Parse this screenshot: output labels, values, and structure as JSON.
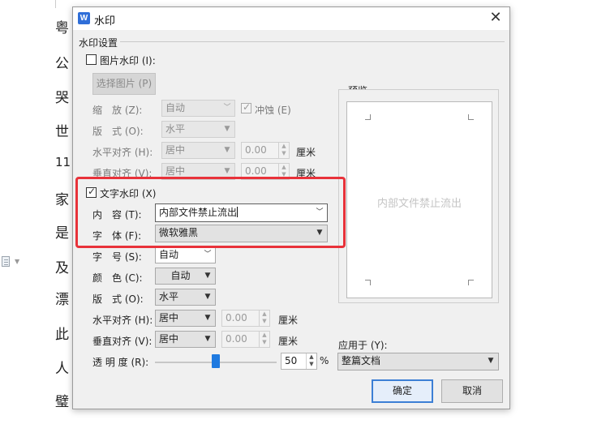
{
  "background_doc": {
    "chars": [
      "粤",
      "公",
      "哭",
      "世",
      "11",
      "家",
      "是",
      "及",
      "漂",
      "此",
      "人",
      "璧"
    ]
  },
  "dialog": {
    "title": "水印",
    "close_glyph": "✕",
    "section_label": "水印设置",
    "picture": {
      "checkbox_label": "图片水印 (I):",
      "choose_btn": "选择图片 (P)",
      "scale_label": "缩　放 (Z):",
      "scale_value": "自动",
      "washout_label": "冲蚀 (E)",
      "layout_label": "版　式 (O):",
      "layout_value": "水平",
      "h_align_label": "水平对齐 (H):",
      "h_align_value": "居中",
      "h_offset": "0.00",
      "h_unit": "厘米",
      "v_align_label": "垂直对齐 (V):",
      "v_align_value": "居中",
      "v_offset": "0.00",
      "v_unit": "厘米"
    },
    "text": {
      "checkbox_label": "文字水印 (X)",
      "content_label": "内　容 (T):",
      "content_value": "内部文件禁止流出",
      "font_label": "字　体 (F):",
      "font_value": "微软雅黑",
      "size_label": "字　号 (S):",
      "size_value": "自动",
      "color_label": "颜　色 (C):",
      "color_value": "自动",
      "layout_label": "版　式 (O):",
      "layout_value": "水平",
      "h_align_label": "水平对齐 (H):",
      "h_align_value": "居中",
      "h_offset": "0.00",
      "h_unit": "厘米",
      "v_align_label": "垂直对齐 (V):",
      "v_align_value": "居中",
      "v_offset": "0.00",
      "v_unit": "厘米",
      "transparency_label": "透 明 度 (R):",
      "transparency_value": "50",
      "transparency_percent": 50,
      "percent_sign": "%"
    },
    "preview": {
      "label": "预览",
      "watermark_text": "内部文件禁止流出"
    },
    "apply_to": {
      "label": "应用于 (Y):",
      "value": "整篇文档"
    },
    "ok_label": "确定",
    "cancel_label": "取消"
  },
  "colors": {
    "accent": "#1f7ae0",
    "highlight": "#e8323a"
  }
}
